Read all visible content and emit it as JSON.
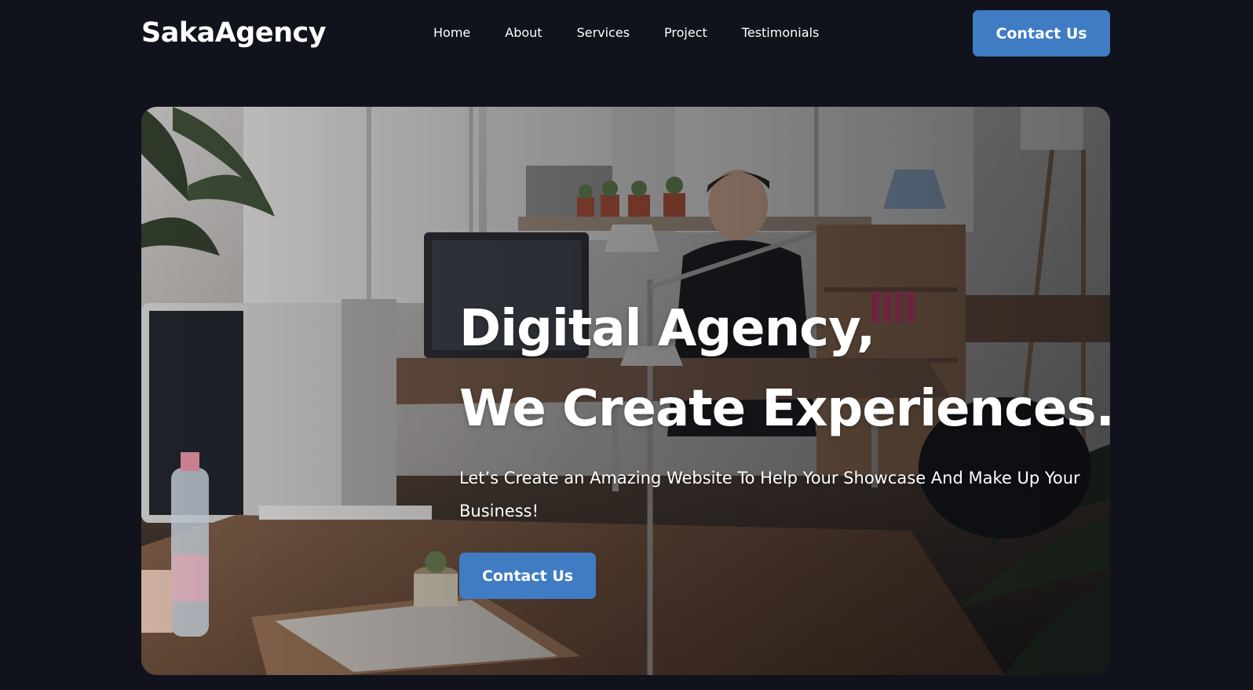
{
  "header": {
    "logo": "SakaAgency",
    "nav": [
      {
        "label": "Home"
      },
      {
        "label": "About"
      },
      {
        "label": "Services"
      },
      {
        "label": "Project"
      },
      {
        "label": "Testimonials"
      }
    ],
    "cta_label": "Contact Us"
  },
  "hero": {
    "image_name": "office-workspace-photo",
    "title_line1": "Digital Agency,",
    "title_line2": "We Create Experiences.",
    "subtitle": "Let’s Create an Amazing Website To Help Your Showcase And Make Up Your Business!",
    "cta_label": "Contact Us"
  },
  "colors": {
    "background": "#10121c",
    "accent": "#3f7cc4",
    "text": "#ffffff"
  }
}
